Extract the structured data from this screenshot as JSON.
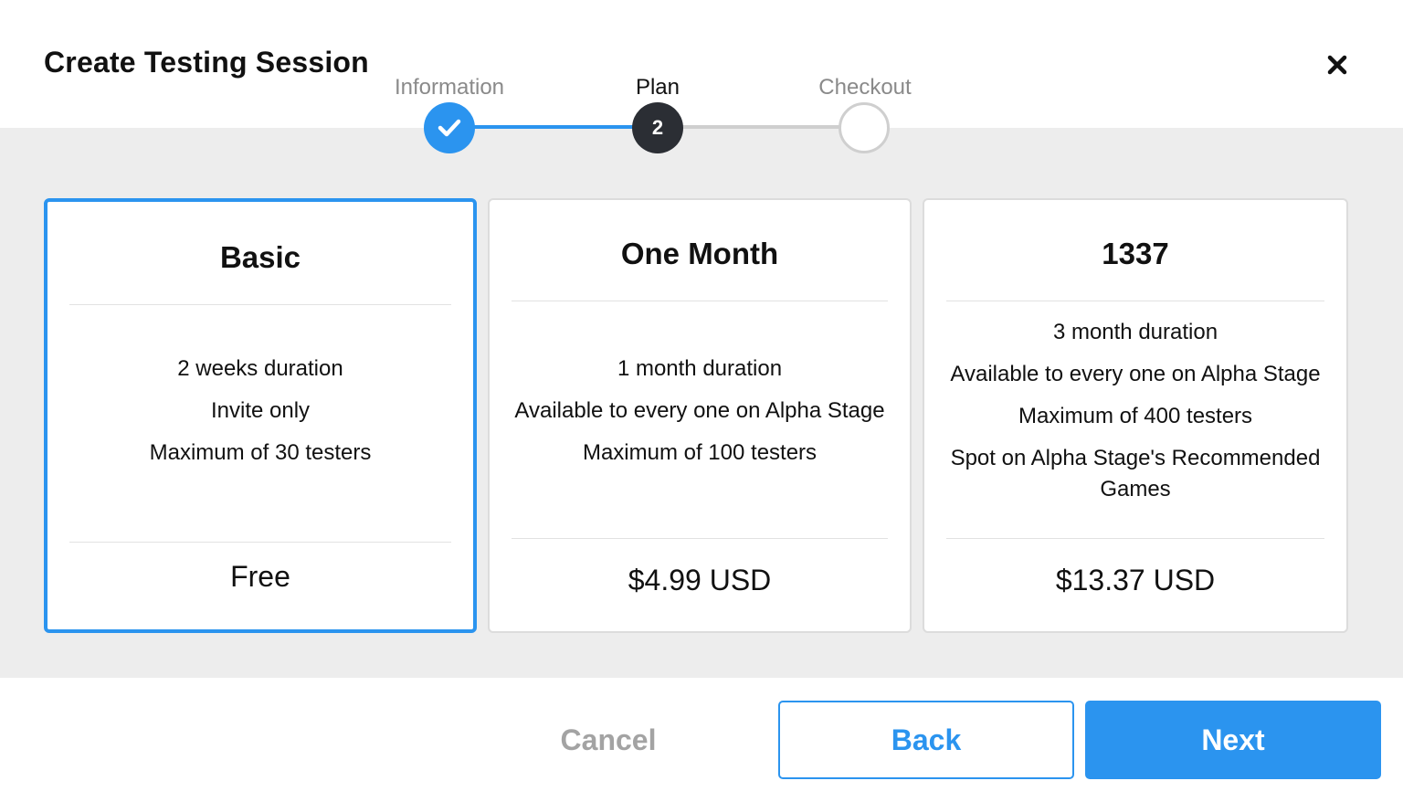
{
  "dialog": {
    "title": "Create Testing Session",
    "close_icon": "close-x-icon"
  },
  "stepper": {
    "steps": [
      {
        "label": "Information",
        "state": "completed",
        "icon": "check-icon"
      },
      {
        "label": "Plan",
        "state": "active",
        "number": "2"
      },
      {
        "label": "Checkout",
        "state": "pending"
      }
    ]
  },
  "plans": [
    {
      "name": "Basic",
      "selected": true,
      "features": [
        "2 weeks duration",
        "Invite only",
        "Maximum of 30 testers"
      ],
      "price": "Free"
    },
    {
      "name": "One Month",
      "selected": false,
      "features": [
        "1 month duration",
        "Available to every one on Alpha Stage",
        "Maximum of 100 testers"
      ],
      "price": "$4.99 USD"
    },
    {
      "name": "1337",
      "selected": false,
      "features": [
        "3 month duration",
        "Available to every one on Alpha Stage",
        "Maximum of 400 testers",
        "Spot on Alpha Stage's Recommended Games"
      ],
      "price": "$13.37 USD"
    }
  ],
  "footer": {
    "cancel_label": "Cancel",
    "back_label": "Back",
    "next_label": "Next"
  },
  "colors": {
    "accent": "#2b94ef",
    "active_step": "#2b2e34",
    "band_background": "#ededed"
  }
}
